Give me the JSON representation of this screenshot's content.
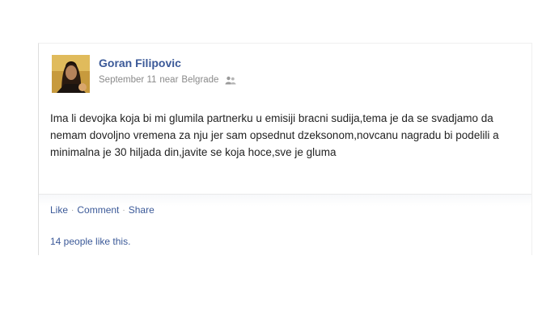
{
  "post": {
    "author": "Goran Filipovic",
    "time": "September 11",
    "location_prefix": "near",
    "location": "Belgrade",
    "privacy_icon": "friends-icon",
    "message": "Ima li devojka koja bi mi glumila partnerku u emisiji bracni sudija,tema je da se svadjamo da nemam dovoljno vremena za nju jer sam opsednut dzeksonom,novcanu nagradu bi podelili a minimalna je 30 hiljada din,javite se koja hoce,sve je gluma",
    "actions": {
      "like": "Like",
      "comment": "Comment",
      "share": "Share",
      "separator": "·"
    },
    "likes_text": "14 people like this."
  },
  "colors": {
    "link": "#3b5998",
    "meta": "#8a8a8a",
    "text": "#222222"
  }
}
